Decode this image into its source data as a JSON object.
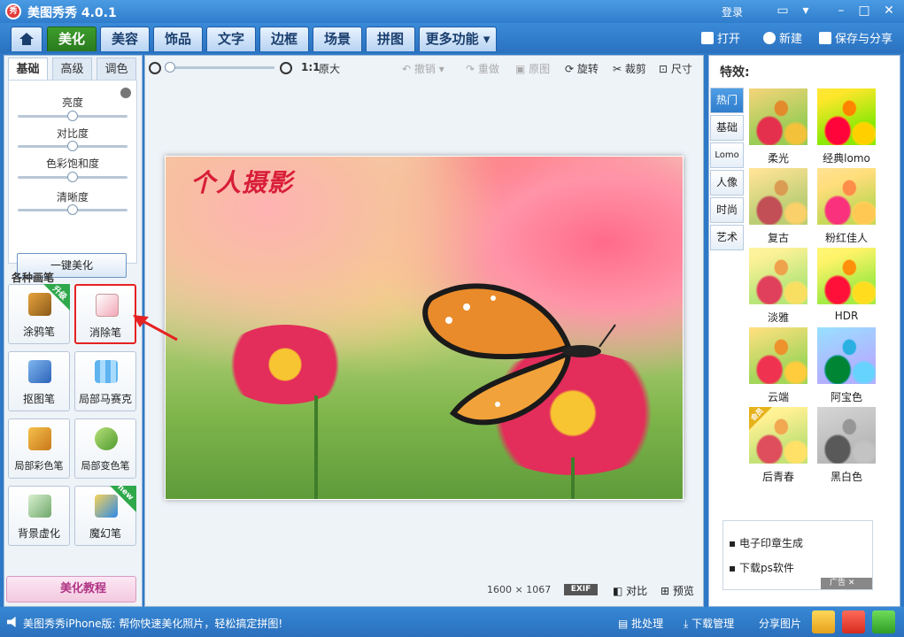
{
  "app": {
    "logo_text": "秀",
    "title": "美图秀秀 4.0.1",
    "login": "登录"
  },
  "nav": {
    "tabs": [
      "美化",
      "美容",
      "饰品",
      "文字",
      "边框",
      "场景",
      "拼图",
      "更多功能 ▾"
    ],
    "open": "打开",
    "new": "新建",
    "save_share": "保存与分享"
  },
  "left": {
    "subtabs": [
      "基础",
      "高级",
      "调色"
    ],
    "sliders": [
      {
        "label": "亮度",
        "level": 0.5
      },
      {
        "label": "对比度",
        "level": 0.5
      },
      {
        "label": "色彩饱和度",
        "level": 0.5
      },
      {
        "label": "清晰度",
        "level": 0.5
      }
    ],
    "one_click": "一键美化",
    "brushes_title": "各种画笔",
    "tools": [
      {
        "label": "涂鸦笔",
        "badge": "升级"
      },
      {
        "label": "消除笔"
      },
      {
        "label": "抠图笔"
      },
      {
        "label": "局部马赛克"
      },
      {
        "label": "局部彩色笔"
      },
      {
        "label": "局部变色笔"
      },
      {
        "label": "背景虚化"
      },
      {
        "label": "魔幻笔",
        "badge": "new"
      }
    ],
    "tutorial": "美化教程"
  },
  "toolbar": {
    "ratio": "1:1",
    "original_size": "原大",
    "undo": "撤销",
    "redo": "重做",
    "original": "原图",
    "rotate": "旋转",
    "crop": "裁剪",
    "size": "尺寸"
  },
  "canvas": {
    "caption": "个人摄影",
    "width": "1600",
    "x": "×",
    "height": "1067",
    "exif": "EXIF",
    "compare": "对比",
    "preview": "预览"
  },
  "effects": {
    "title": "特效:",
    "tabs": [
      "热门",
      "基础",
      "Lomo",
      "人像",
      "时尚",
      "艺术"
    ],
    "items": [
      "柔光",
      "经典lomo",
      "复古",
      "粉红佳人",
      "淡雅",
      "HDR",
      "云端",
      "阿宝色",
      "后青春",
      "黑白色"
    ],
    "vip_badge": "会员"
  },
  "ads": {
    "links": [
      "电子印章生成",
      "下载ps软件"
    ],
    "badge": "广告"
  },
  "status": {
    "message": "美图秀秀iPhone版: 帮你快速美化照片，轻松搞定拼图!",
    "batch": "批处理",
    "download": "下载管理",
    "share": "分享图片"
  },
  "colors": {
    "accent_green": "#2a7a1e",
    "brand_blue": "#2f7dcc",
    "highlight_red": "#e52222"
  }
}
